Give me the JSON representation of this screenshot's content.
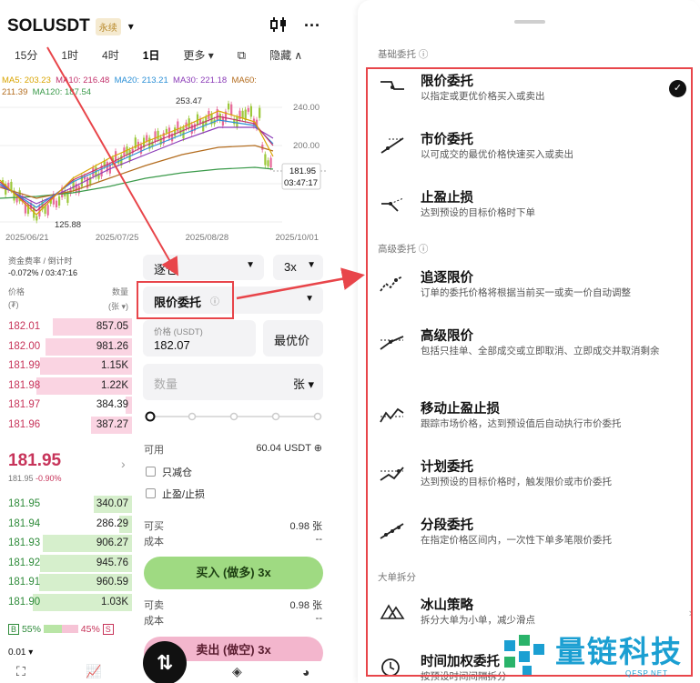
{
  "header": {
    "symbol": "SOLUSDT",
    "perp_badge": "永续",
    "caret": "▾",
    "candle_icon": "candlestick-icon",
    "more": "···"
  },
  "timeframes": {
    "items": [
      "15分",
      "1时",
      "4时",
      "1日",
      "更多 ▾"
    ],
    "active": "1日",
    "hide_label": "隐藏 ∧"
  },
  "ma": {
    "ma5": "MA5: 203.23",
    "ma10": "MA10: 216.48",
    "ma20": "MA20: 213.21",
    "ma30": "MA30: 221.18",
    "ma60": "MA60:",
    "ma60v": "211.39",
    "ma120": "MA120: 187.54"
  },
  "chart_labels": {
    "high": "253.47",
    "low": "125.88",
    "y240": "240.00",
    "y200": "200.00",
    "last": "181.95",
    "countdown": "03:47:17"
  },
  "xaxis": [
    "2025/06/21",
    "2025/07/25",
    "2025/08/28",
    "2025/10/01"
  ],
  "funding": {
    "label": "资金费率 / 倒计时",
    "value": "-0.072% / 03:47:16"
  },
  "orderbook": {
    "price_hdr": "价格",
    "price_unit": "(₮)",
    "qty_hdr": "数量",
    "qty_unit": "(张 ▾)",
    "asks": [
      {
        "price": "182.01",
        "qty": "857.05",
        "depth": 0.62
      },
      {
        "price": "182.00",
        "qty": "981.26",
        "depth": 0.68
      },
      {
        "price": "181.99",
        "qty": "1.15K",
        "depth": 0.72
      },
      {
        "price": "181.98",
        "qty": "1.22K",
        "depth": 0.75
      },
      {
        "price": "181.97",
        "qty": "384.39",
        "depth": 0.05
      },
      {
        "price": "181.96",
        "qty": "387.27",
        "depth": 0.32
      }
    ],
    "mid_price": "181.95",
    "mid_sub_price": "181.95",
    "mid_sub_change": "-0.90%",
    "bids": [
      {
        "price": "181.95",
        "qty": "340.07",
        "depth": 0.3
      },
      {
        "price": "181.94",
        "qty": "286.29",
        "depth": 0.1
      },
      {
        "price": "181.93",
        "qty": "906.27",
        "depth": 0.7
      },
      {
        "price": "181.92",
        "qty": "945.76",
        "depth": 0.72
      },
      {
        "price": "181.91",
        "qty": "960.59",
        "depth": 0.73
      },
      {
        "price": "181.90",
        "qty": "1.03K",
        "depth": 0.78
      }
    ],
    "buy_ratio": "55%",
    "sell_ratio": "45%",
    "b": "B",
    "s": "S",
    "precision": "0.01"
  },
  "form": {
    "margin_mode": "逐仓",
    "leverage": "3x",
    "order_type": "限价委托",
    "order_type_info": "ⓘ",
    "price_label": "价格 (USDT)",
    "price_value": "182.07",
    "best_price": "最优价",
    "qty_placeholder": "数量",
    "qty_unit": "张 ▾",
    "avail_label": "可用",
    "avail_value": "60.04 USDT ⊕",
    "reduce_only": "只减仓",
    "tp_sl": "止盈/止损",
    "can_buy_label": "可买",
    "can_buy_value": "0.98 张",
    "cost_label": "成本",
    "cost_value": "--",
    "buy_btn": "买入 (做多) 3x",
    "can_sell_label": "可卖",
    "can_sell_value": "0.98 张",
    "cost2_label": "成本",
    "cost2_value": "--",
    "sell_btn": "卖出 (做空) 3x"
  },
  "panel": {
    "basic_section": "基础委托 ⓘ",
    "advanced_section": "高级委托 ⓘ",
    "big_section": "大单拆分",
    "items": [
      {
        "title": "限价委托",
        "desc": "以指定或更优价格买入或卖出",
        "icon": "limit-order-icon"
      },
      {
        "title": "市价委托",
        "desc": "以可成交的最优价格快速买入或卖出",
        "icon": "market-order-icon"
      },
      {
        "title": "止盈止损",
        "desc": "达到预设的目标价格时下单",
        "icon": "tp-sl-icon"
      },
      {
        "title": "追逐限价",
        "desc": "订单的委托价格将根据当前买一或卖一价自动调整",
        "icon": "chase-limit-icon"
      },
      {
        "title": "高级限价",
        "desc": "包括只挂单、全部成交或立即取消、立即成交并取消剩余",
        "icon": "advanced-limit-icon"
      },
      {
        "title": "移动止盈止损",
        "desc": "跟踪市场价格，达到预设值后自动执行市价委托",
        "icon": "trailing-stop-icon"
      },
      {
        "title": "计划委托",
        "desc": "达到预设的目标价格时，触发限价或市价委托",
        "icon": "trigger-order-icon"
      },
      {
        "title": "分段委托",
        "desc": "在指定价格区间内，一次性下单多笔限价委托",
        "icon": "scaled-order-icon"
      },
      {
        "title": "冰山策略",
        "desc": "拆分大单为小单，减少滑点",
        "icon": "iceberg-icon"
      },
      {
        "title": "时间加权委托",
        "desc": "按预设时间间隔拆分",
        "icon": "twap-clock-icon"
      }
    ],
    "selected_index": 0
  },
  "watermark": {
    "text": "量链科技",
    "sub": "QFSP.NET"
  },
  "colors": {
    "red": "#c7345a",
    "green": "#2e8b3a",
    "annotation": "#e8454a",
    "buy": "#9fda82",
    "sell": "#f3b6cd"
  }
}
